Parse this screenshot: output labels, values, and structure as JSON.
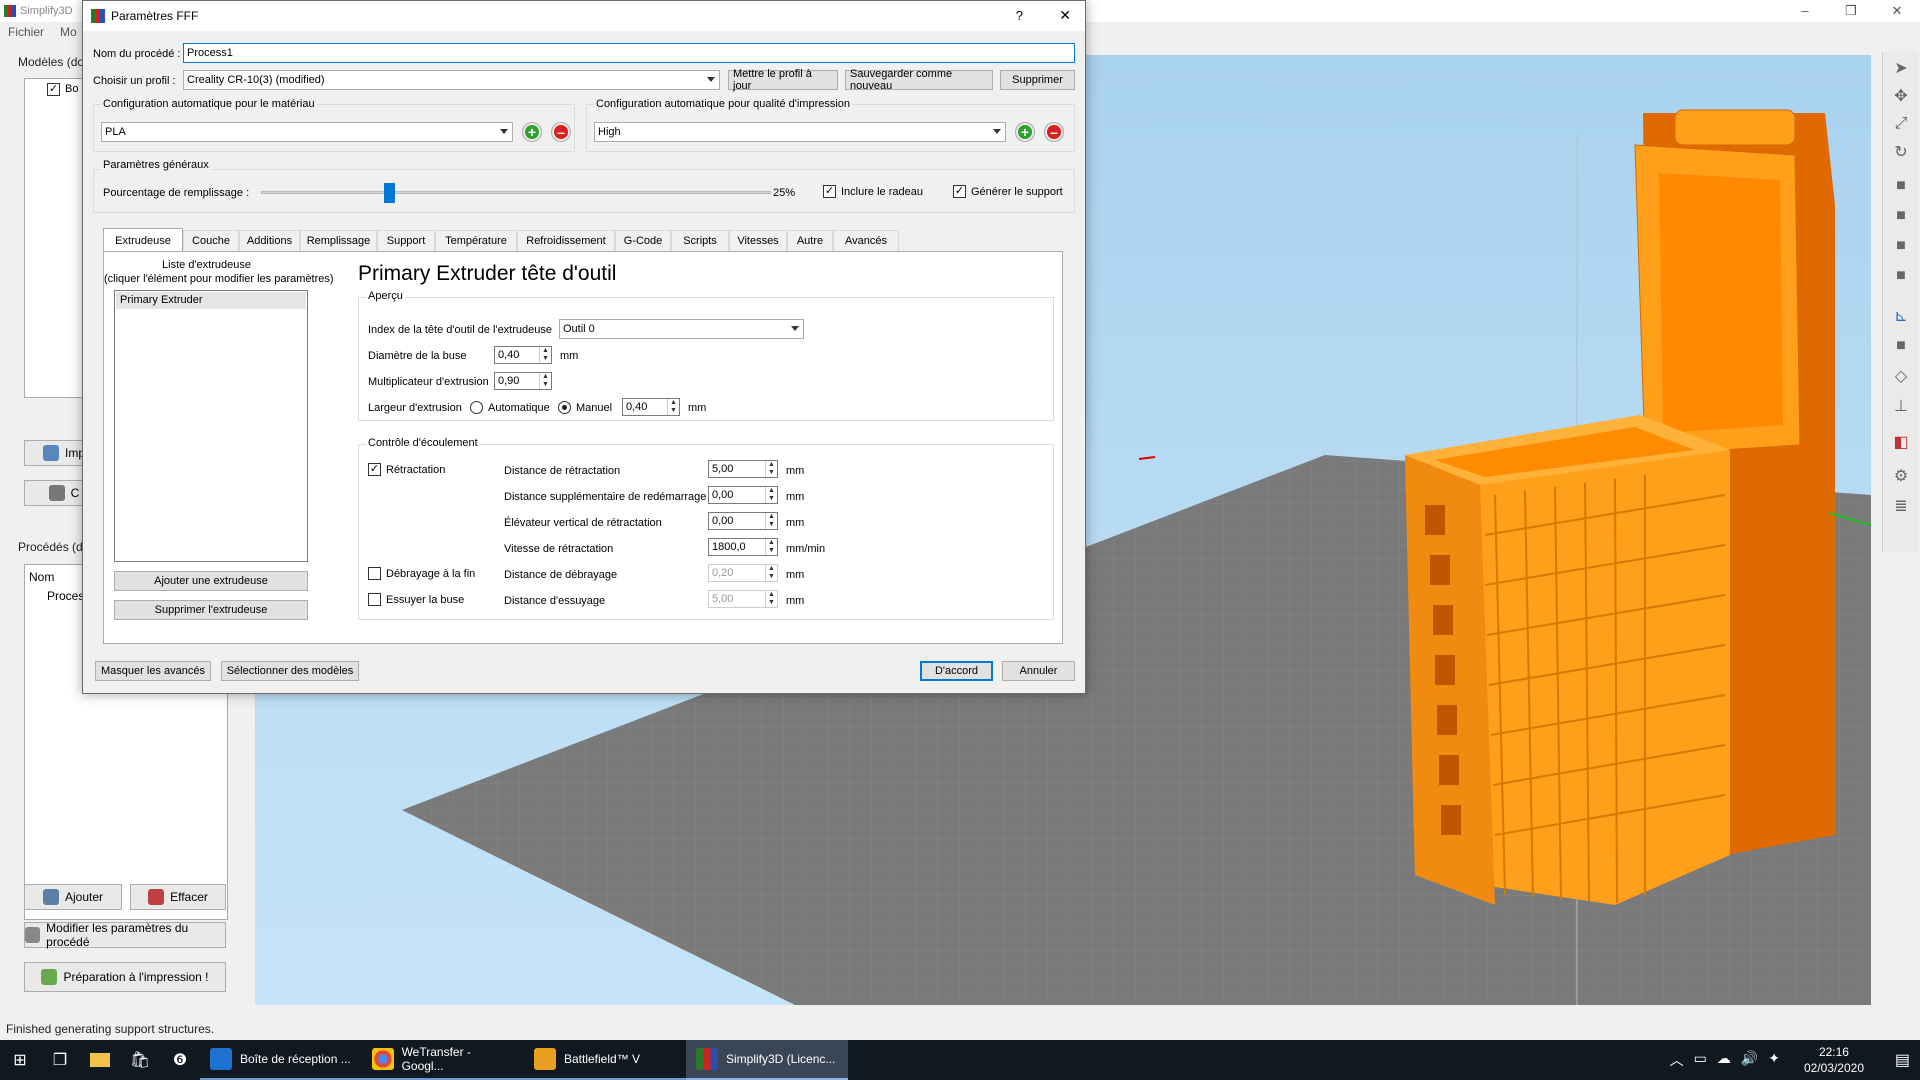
{
  "main": {
    "title": "Simplify3D",
    "menu": [
      "Fichier",
      "Mo"
    ],
    "status": "Finished generating support structures.",
    "models_group": "Modèles (do",
    "model_item": "Bo",
    "btn_import": "Imp",
    "btn_center": "C",
    "process_group": "Procédés (do",
    "process_col": "Nom",
    "process_item": "Proces",
    "btn_add": "Ajouter",
    "btn_delete": "Effacer",
    "btn_edit_process": "Modifier les paramètres du procédé",
    "btn_prepare": "Préparation à l'impression !"
  },
  "window_controls": {
    "minimize": "–",
    "maximize": "❐",
    "close": "✕"
  },
  "dialog": {
    "title": "Paramètres FFF",
    "help": "?",
    "close": "✕",
    "process_name_label": "Nom du procédé :",
    "process_name_value": "Process1",
    "profile_label": "Choisir un profil :",
    "profile_value": "Creality CR-10(3) (modified)",
    "btn_update_profile": "Mettre le profil à jour",
    "btn_save_new": "Sauvegarder comme nouveau",
    "btn_remove": "Supprimer",
    "material_group": "Configuration automatique pour le matériau",
    "material_value": "PLA",
    "quality_group": "Configuration automatique pour qualité d'impression",
    "quality_value": "High",
    "general_group": "Paramètres généraux",
    "infill_label": "Pourcentage de remplissage :",
    "infill_value": "25%",
    "infill_fraction": 0.25,
    "raft_label": "Inclure le radeau",
    "raft_checked": true,
    "support_label": "Générer le support",
    "support_checked": true,
    "tabs": [
      "Extrudeuse",
      "Couche",
      "Additions",
      "Remplissage",
      "Support",
      "Température",
      "Refroidissement",
      "G-Code",
      "Scripts",
      "Vitesses",
      "Autre",
      "Avancés"
    ],
    "extruder_list_title": "Liste d'extrudeuse",
    "extruder_list_hint": "(cliquer l'élément pour modifier les paramètres)",
    "extruder_item": "Primary Extruder",
    "btn_add_extruder": "Ajouter une extrudeuse",
    "btn_remove_extruder": "Supprimer l'extrudeuse",
    "extruder_heading": "Primary Extruder tête d'outil",
    "overview_group": "Aperçu",
    "toolhead_label": "Index de la tête d'outil de l'extrudeuse",
    "toolhead_value": "Outil 0",
    "nozzle_label": "Diamètre de la buse",
    "nozzle_value": "0,40",
    "nozzle_unit": "mm",
    "multiplier_label": "Multiplicateur d'extrusion",
    "multiplier_value": "0,90",
    "width_label": "Largeur d'extrusion",
    "width_auto": "Automatique",
    "width_manual": "Manuel",
    "width_value": "0,40",
    "width_unit": "mm",
    "ooze_group": "Contrôle d'écoulement",
    "retraction_label": "Rétractation",
    "retraction_checked": true,
    "retract_dist_label": "Distance de rétractation",
    "retract_dist_value": "5,00",
    "retract_dist_unit": "mm",
    "restart_dist_label": "Distance supplémentaire de redémarrage",
    "restart_dist_value": "0,00",
    "restart_dist_unit": "mm",
    "lift_label": "Élévateur vertical de rétractation",
    "lift_value": "0,00",
    "lift_unit": "mm",
    "retract_speed_label": "Vitesse de rétractation",
    "retract_speed_value": "1800,0",
    "retract_speed_unit": "mm/min",
    "coast_label": "Débrayage à la fin",
    "coast_checked": false,
    "coast_dist_label": "Distance de débrayage",
    "coast_dist_value": "0,20",
    "coast_dist_unit": "mm",
    "wipe_label": "Essuyer la buse",
    "wipe_checked": false,
    "wipe_dist_label": "Distance d'essuyage",
    "wipe_dist_value": "5,00",
    "wipe_dist_unit": "mm",
    "btn_hide_advanced": "Masquer les avancés",
    "btn_select_models": "Sélectionner des modèles",
    "btn_ok": "D'accord",
    "btn_cancel": "Annuler"
  },
  "taskbar": {
    "apps": [
      "Boîte de réception ...",
      "WeTransfer - Googl...",
      "Battlefield™ V",
      "Simplify3D (Licenc..."
    ],
    "time": "22:16",
    "date": "02/03/2020"
  },
  "colors": {
    "accent": "#0078d7",
    "model": "#ff9f1a",
    "model_dark": "#e06a00",
    "floor": "#7a7a7a"
  }
}
